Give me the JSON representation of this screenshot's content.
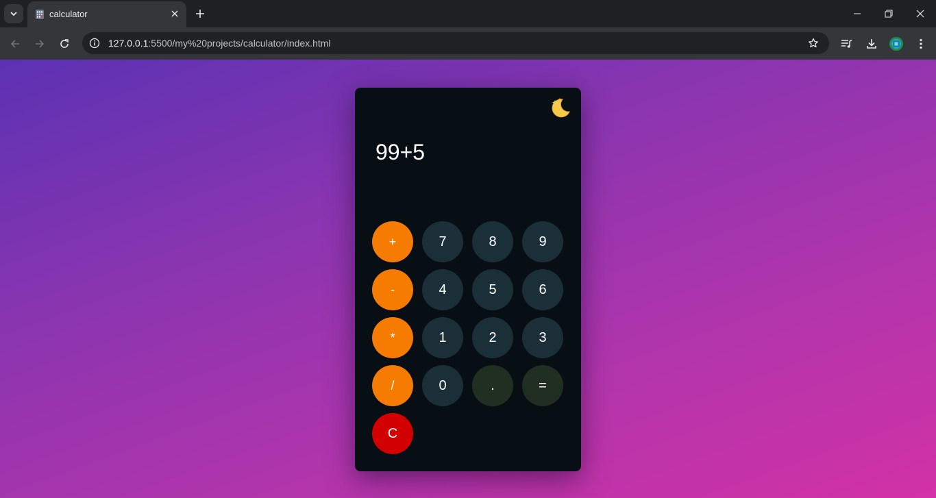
{
  "browser": {
    "tab": {
      "title": "calculator"
    },
    "address": {
      "host": "127.0.0.1",
      "path": ":5500/my%20projects/calculator/index.html"
    },
    "icons": [
      "tab-search-icon",
      "close-icon",
      "plus-icon",
      "minimize-icon",
      "restore-icon",
      "close-window-icon",
      "back-arrow-icon",
      "forward-arrow-icon",
      "reload-icon",
      "site-info-icon",
      "star-icon",
      "media-control-icon",
      "download-icon",
      "extension-icon",
      "kebab-menu-icon"
    ]
  },
  "calculator": {
    "display": "99+5",
    "theme_toggle_icon": "moon-stars-icon",
    "keys": [
      {
        "label": "+",
        "name": "plus",
        "kind": "op"
      },
      {
        "label": "7",
        "name": "7",
        "kind": "num"
      },
      {
        "label": "8",
        "name": "8",
        "kind": "num"
      },
      {
        "label": "9",
        "name": "9",
        "kind": "num"
      },
      {
        "label": "-",
        "name": "minus",
        "kind": "op"
      },
      {
        "label": "4",
        "name": "4",
        "kind": "num"
      },
      {
        "label": "5",
        "name": "5",
        "kind": "num"
      },
      {
        "label": "6",
        "name": "6",
        "kind": "num"
      },
      {
        "label": "*",
        "name": "multiply",
        "kind": "op"
      },
      {
        "label": "1",
        "name": "1",
        "kind": "num"
      },
      {
        "label": "2",
        "name": "2",
        "kind": "num"
      },
      {
        "label": "3",
        "name": "3",
        "kind": "num"
      },
      {
        "label": "/",
        "name": "divide",
        "kind": "op"
      },
      {
        "label": "0",
        "name": "0",
        "kind": "num"
      },
      {
        "label": ".",
        "name": "decimal",
        "kind": "dark"
      },
      {
        "label": "=",
        "name": "equals",
        "kind": "dark"
      },
      {
        "label": "C",
        "name": "clear",
        "kind": "clear"
      }
    ]
  },
  "colors": {
    "operator": "#f57c00",
    "number": "#1b2f39",
    "special": "#202f22",
    "clear": "#d20000",
    "panel": "#080f14"
  }
}
